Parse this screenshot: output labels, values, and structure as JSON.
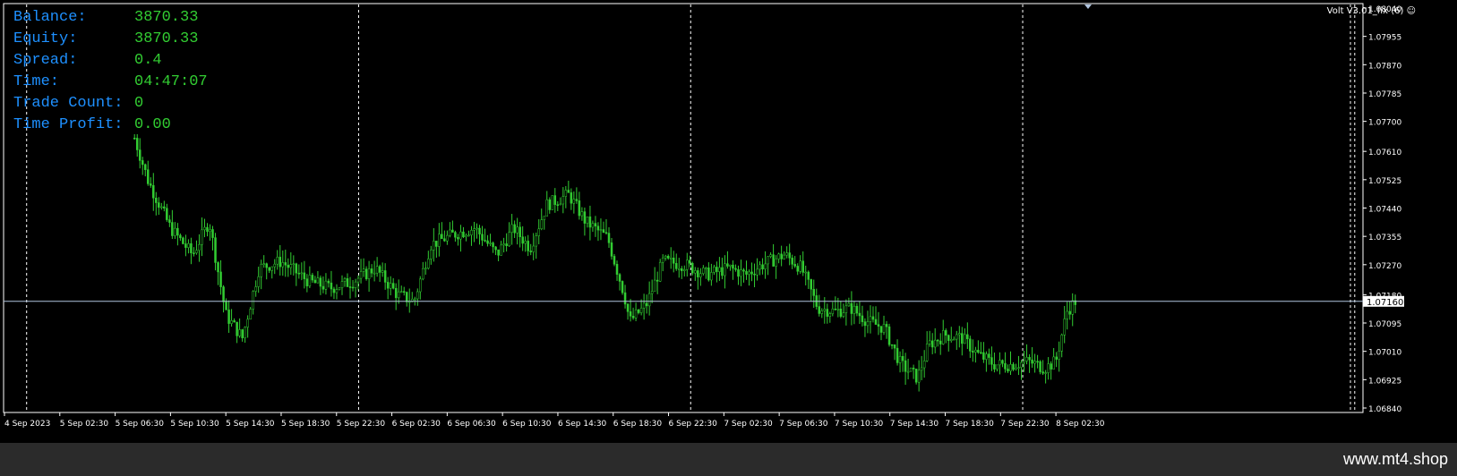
{
  "info_panel": {
    "rows": [
      {
        "label": "Balance:",
        "value": "3870.33"
      },
      {
        "label": "Equity:",
        "value": "3870.33"
      },
      {
        "label": "Spread:",
        "value": "0.4"
      },
      {
        "label": "Time:",
        "value": "04:47:07"
      },
      {
        "label": "Trade Count:",
        "value": "0"
      },
      {
        "label": "Time Profit:",
        "value": "0.00"
      }
    ]
  },
  "indicator_label": "Volt V3.01_fix (6)",
  "watermark": "www.mt4.shop",
  "current_price_label": "1.07160",
  "colors": {
    "background": "#000000",
    "candles": "#32cd32",
    "labels": "#1e90ff",
    "values": "#32cd32",
    "grid": "#ffffff",
    "price_line": "#b0c4de"
  },
  "chart_data": {
    "type": "candlestick",
    "y_ticks": [
      "1.08040",
      "1.07955",
      "1.07870",
      "1.07785",
      "1.07700",
      "1.07610",
      "1.07525",
      "1.07440",
      "1.07355",
      "1.07270",
      "1.07180",
      "1.07095",
      "1.07010",
      "1.06925",
      "1.06840"
    ],
    "ylim": [
      1.0684,
      1.0804
    ],
    "x_ticks": [
      "4 Sep 2023",
      "5 Sep 02:30",
      "5 Sep 06:30",
      "5 Sep 10:30",
      "5 Sep 14:30",
      "5 Sep 18:30",
      "5 Sep 22:30",
      "6 Sep 02:30",
      "6 Sep 06:30",
      "6 Sep 10:30",
      "6 Sep 14:30",
      "6 Sep 18:30",
      "6 Sep 22:30",
      "7 Sep 02:30",
      "7 Sep 06:30",
      "7 Sep 10:30",
      "7 Sep 14:30",
      "7 Sep 18:30",
      "7 Sep 22:30",
      "8 Sep 02:30"
    ],
    "current_price": 1.0716,
    "price_path": [
      [
        2.35,
        1.0765
      ],
      [
        2.6,
        1.0752
      ],
      [
        3.0,
        1.0738
      ],
      [
        3.4,
        1.073
      ],
      [
        3.7,
        1.074
      ],
      [
        4.0,
        1.0712
      ],
      [
        4.3,
        1.0705
      ],
      [
        4.6,
        1.0726
      ],
      [
        5.0,
        1.0728
      ],
      [
        5.5,
        1.0722
      ],
      [
        5.9,
        1.072
      ],
      [
        6.3,
        1.0722
      ],
      [
        6.7,
        1.0726
      ],
      [
        7.1,
        1.0718
      ],
      [
        7.4,
        1.0716
      ],
      [
        7.7,
        1.0733
      ],
      [
        8.1,
        1.0736
      ],
      [
        8.5,
        1.0738
      ],
      [
        8.9,
        1.073
      ],
      [
        9.2,
        1.0738
      ],
      [
        9.5,
        1.0732
      ],
      [
        9.8,
        1.0745
      ],
      [
        10.2,
        1.0748
      ],
      [
        10.5,
        1.074
      ],
      [
        10.9,
        1.0735
      ],
      [
        11.2,
        1.0718
      ],
      [
        11.3,
        1.071
      ],
      [
        11.6,
        1.0715
      ],
      [
        11.9,
        1.0728
      ],
      [
        12.3,
        1.0727
      ],
      [
        12.7,
        1.0724
      ],
      [
        13.1,
        1.0726
      ],
      [
        13.4,
        1.0724
      ],
      [
        13.7,
        1.0727
      ],
      [
        14.1,
        1.073
      ],
      [
        14.4,
        1.0726
      ],
      [
        14.7,
        1.0714
      ],
      [
        15.0,
        1.0713
      ],
      [
        15.3,
        1.0714
      ],
      [
        15.6,
        1.071
      ],
      [
        15.9,
        1.0708
      ],
      [
        16.2,
        1.0697
      ],
      [
        16.5,
        1.0693
      ],
      [
        16.7,
        1.0703
      ],
      [
        17.0,
        1.0706
      ],
      [
        17.3,
        1.0705
      ],
      [
        17.6,
        1.07
      ],
      [
        17.9,
        1.0697
      ],
      [
        18.2,
        1.0697
      ],
      [
        18.5,
        1.0698
      ],
      [
        18.8,
        1.0696
      ],
      [
        19.0,
        1.0698
      ],
      [
        19.2,
        1.0713
      ],
      [
        19.35,
        1.0716
      ]
    ]
  }
}
